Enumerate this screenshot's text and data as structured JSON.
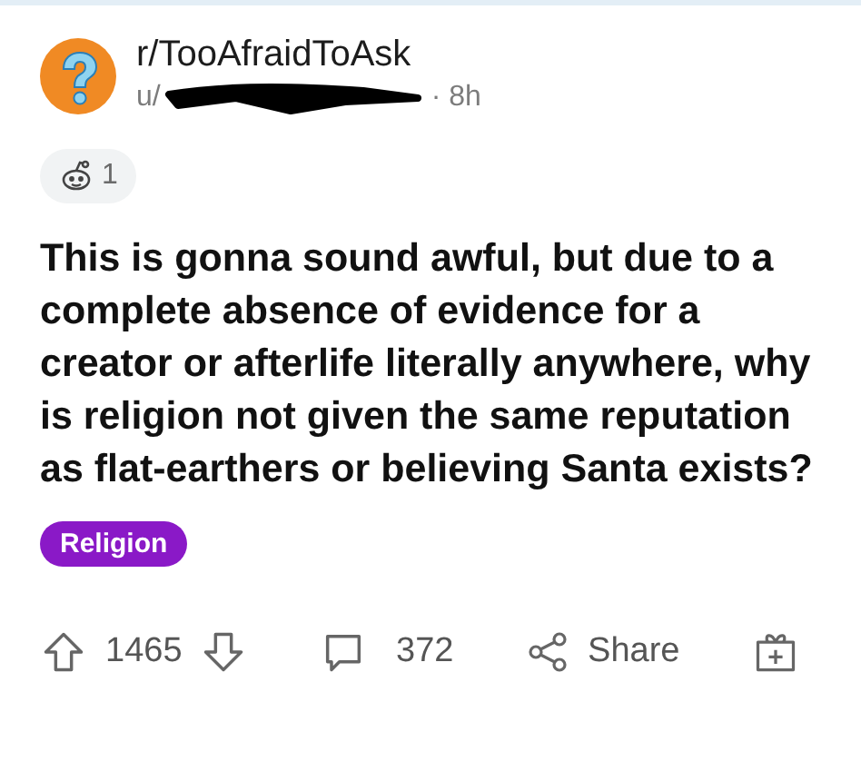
{
  "post": {
    "subreddit": "r/TooAfraidToAsk",
    "meta_prefix": "u/",
    "meta_suffix": "· 8h",
    "award_count": "1",
    "title": "This is gonna sound awful, but due to a complete absence of evidence for a creator or afterlife literally anywhere, why is religion not given the same reputation as flat-earthers or believing Santa exists?",
    "flair": {
      "label": "Religion",
      "color": "#8a19c7"
    }
  },
  "actions": {
    "score": "1465",
    "comments": "372",
    "share": "Share"
  }
}
